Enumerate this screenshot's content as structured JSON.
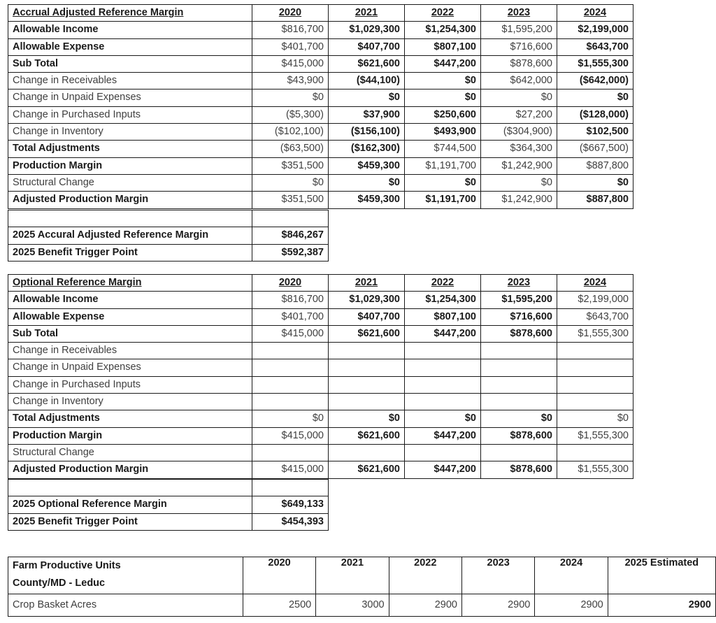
{
  "accrual_table": {
    "title": "Accrual Adjusted Reference Margin",
    "years": [
      "2020",
      "2021",
      "2022",
      "2023",
      "2024"
    ],
    "rows": [
      {
        "label": "Allowable Income",
        "label_bold": true,
        "values": [
          "$816,700",
          "$1,029,300",
          "$1,254,300",
          "$1,595,200",
          "$2,199,000"
        ],
        "bold": [
          false,
          true,
          true,
          false,
          true
        ]
      },
      {
        "label": "Allowable Expense",
        "label_bold": true,
        "values": [
          "$401,700",
          "$407,700",
          "$807,100",
          "$716,600",
          "$643,700"
        ],
        "bold": [
          false,
          true,
          true,
          false,
          true
        ]
      },
      {
        "label": "Sub Total",
        "label_bold": true,
        "values": [
          "$415,000",
          "$621,600",
          "$447,200",
          "$878,600",
          "$1,555,300"
        ],
        "bold": [
          false,
          true,
          true,
          false,
          true
        ]
      },
      {
        "label": "Change in Receivables",
        "label_bold": false,
        "values": [
          "$43,900",
          "($44,100)",
          "$0",
          "$642,000",
          "($642,000)"
        ],
        "bold": [
          false,
          true,
          true,
          false,
          true
        ]
      },
      {
        "label": "Change in Unpaid Expenses",
        "label_bold": false,
        "values": [
          "$0",
          "$0",
          "$0",
          "$0",
          "$0"
        ],
        "bold": [
          false,
          true,
          true,
          false,
          true
        ]
      },
      {
        "label": "Change in Purchased Inputs",
        "label_bold": false,
        "values": [
          "($5,300)",
          "$37,900",
          "$250,600",
          "$27,200",
          "($128,000)"
        ],
        "bold": [
          false,
          true,
          true,
          false,
          true
        ]
      },
      {
        "label": "Change in Inventory",
        "label_bold": false,
        "values": [
          "($102,100)",
          "($156,100)",
          "$493,900",
          "($304,900)",
          "$102,500"
        ],
        "bold": [
          false,
          true,
          true,
          false,
          true
        ]
      },
      {
        "label": "Total Adjustments",
        "label_bold": true,
        "values": [
          "($63,500)",
          "($162,300)",
          "$744,500",
          "$364,300",
          "($667,500)"
        ],
        "bold": [
          false,
          true,
          false,
          false,
          false
        ]
      },
      {
        "label": "Production Margin",
        "label_bold": true,
        "values": [
          "$351,500",
          "$459,300",
          "$1,191,700",
          "$1,242,900",
          "$887,800"
        ],
        "bold": [
          false,
          true,
          false,
          false,
          false
        ]
      },
      {
        "label": "Structural Change",
        "label_bold": false,
        "values": [
          "$0",
          "$0",
          "$0",
          "$0",
          "$0"
        ],
        "bold": [
          false,
          true,
          true,
          false,
          true
        ]
      },
      {
        "label": "Adjusted Production Margin",
        "label_bold": true,
        "values": [
          "$351,500",
          "$459,300",
          "$1,191,700",
          "$1,242,900",
          "$887,800"
        ],
        "bold": [
          false,
          true,
          true,
          false,
          true
        ]
      }
    ]
  },
  "accrual_summary": {
    "rows": [
      {
        "label": "2025 Accural Adjusted Reference Margin",
        "value": "$846,267"
      },
      {
        "label": "2025 Benefit Trigger Point",
        "value": "$592,387"
      }
    ]
  },
  "optional_table": {
    "title": "Optional Reference Margin",
    "years": [
      "2020",
      "2021",
      "2022",
      "2023",
      "2024"
    ],
    "rows": [
      {
        "label": "Allowable Income",
        "label_bold": true,
        "values": [
          "$816,700",
          "$1,029,300",
          "$1,254,300",
          "$1,595,200",
          "$2,199,000"
        ],
        "bold": [
          false,
          true,
          true,
          true,
          false
        ]
      },
      {
        "label": "Allowable Expense",
        "label_bold": true,
        "values": [
          "$401,700",
          "$407,700",
          "$807,100",
          "$716,600",
          "$643,700"
        ],
        "bold": [
          false,
          true,
          true,
          true,
          false
        ]
      },
      {
        "label": "Sub Total",
        "label_bold": true,
        "values": [
          "$415,000",
          "$621,600",
          "$447,200",
          "$878,600",
          "$1,555,300"
        ],
        "bold": [
          false,
          true,
          true,
          true,
          false
        ]
      },
      {
        "label": "Change in Receivables",
        "label_bold": false,
        "values": [
          "",
          "",
          "",
          "",
          ""
        ],
        "bold": [
          false,
          false,
          false,
          false,
          false
        ]
      },
      {
        "label": "Change in Unpaid Expenses",
        "label_bold": false,
        "values": [
          "",
          "",
          "",
          "",
          ""
        ],
        "bold": [
          false,
          false,
          false,
          false,
          false
        ]
      },
      {
        "label": "Change in Purchased Inputs",
        "label_bold": false,
        "values": [
          "",
          "",
          "",
          "",
          ""
        ],
        "bold": [
          false,
          false,
          false,
          false,
          false
        ]
      },
      {
        "label": "Change in Inventory",
        "label_bold": false,
        "values": [
          "",
          "",
          "",
          "",
          ""
        ],
        "bold": [
          false,
          false,
          false,
          false,
          false
        ]
      },
      {
        "label": "Total Adjustments",
        "label_bold": true,
        "values": [
          "$0",
          "$0",
          "$0",
          "$0",
          "$0"
        ],
        "bold": [
          false,
          true,
          true,
          true,
          false
        ]
      },
      {
        "label": "Production Margin",
        "label_bold": true,
        "values": [
          "$415,000",
          "$621,600",
          "$447,200",
          "$878,600",
          "$1,555,300"
        ],
        "bold": [
          false,
          true,
          true,
          true,
          false
        ]
      },
      {
        "label": "Structural Change",
        "label_bold": false,
        "values": [
          "",
          "",
          "",
          "",
          ""
        ],
        "bold": [
          false,
          false,
          false,
          false,
          false
        ]
      },
      {
        "label": "Adjusted Production Margin",
        "label_bold": true,
        "values": [
          "$415,000",
          "$621,600",
          "$447,200",
          "$878,600",
          "$1,555,300"
        ],
        "bold": [
          false,
          true,
          true,
          true,
          false
        ]
      }
    ]
  },
  "optional_summary": {
    "rows": [
      {
        "label": "2025 Optional Reference Margin",
        "value": "$649,133"
      },
      {
        "label": "2025 Benefit Trigger Point",
        "value": "$454,393"
      }
    ]
  },
  "fpu_table": {
    "title_line1": "Farm Productive Units",
    "title_line2": "County/MD - Leduc",
    "columns": [
      "2020",
      "2021",
      "2022",
      "2023",
      "2024",
      "2025 Estimated"
    ],
    "rows": [
      {
        "label": "Crop Basket Acres",
        "values": [
          "2500",
          "3000",
          "2900",
          "2900",
          "2900",
          "2900"
        ],
        "bold": [
          false,
          false,
          false,
          false,
          false,
          true
        ]
      }
    ]
  }
}
